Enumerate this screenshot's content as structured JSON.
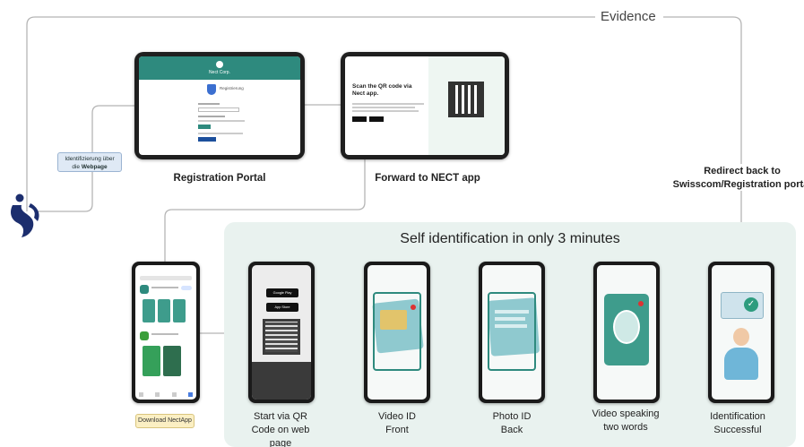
{
  "evidence_label": "Evidence",
  "badge_webpage": {
    "line1": "Identifizierung über",
    "line2_prefix": "die ",
    "line2_bold": "Webpage"
  },
  "registration_portal": {
    "caption": "Registration Portal",
    "header": "Nect Corp.",
    "subtitle": "Registrierung"
  },
  "forward_app": {
    "caption": "Forward to NECT app",
    "heading": "Scan the QR code via Nect app."
  },
  "redirect": {
    "line1": "Redirect back to",
    "line2": "Swisscom/Registration portal"
  },
  "panel_title": "Self identification in only 3 minutes",
  "download_badge": "Download NectApp",
  "steps": [
    {
      "line1": "Start via QR",
      "line2": "Code on web",
      "line3": "page"
    },
    {
      "line1": "Video ID",
      "line2": "Front"
    },
    {
      "line1": "Photo ID",
      "line2": "Back"
    },
    {
      "line1": "Video speaking",
      "line2": "two words"
    },
    {
      "line1": "Identification",
      "line2": "Successful"
    }
  ],
  "store_buttons": {
    "google": "Google Play",
    "apple": "App Store"
  },
  "colors": {
    "teal": "#2e8a7e",
    "panel": "#e9f2ef",
    "line": "#b5b5b5",
    "brand": "#1c2e6e"
  }
}
